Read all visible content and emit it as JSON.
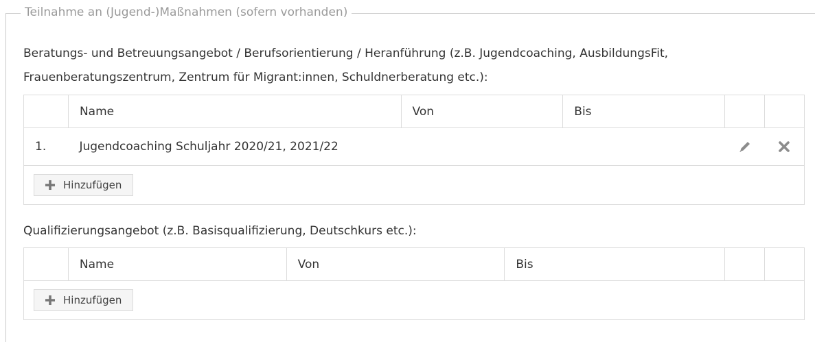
{
  "fieldset": {
    "legend": "Teilnahme an (Jugend-)Maßnahmen (sofern vorhanden)"
  },
  "section1": {
    "label_line1": "Beratungs- und Betreuungsangebot / Berufsorientierung / Heranführung (z.B. Jugendcoaching, AusbildungsFit,",
    "label_line2": "Frauenberatungszentrum, Zentrum für Migrant:innen, Schuldnerberatung etc.):",
    "columns": {
      "name": "Name",
      "von": "Von",
      "bis": "Bis"
    },
    "rows": [
      {
        "index": "1.",
        "name": "Jugendcoaching Schuljahr 2020/21, 2021/22",
        "von": "",
        "bis": ""
      }
    ],
    "add_label": "Hinzufügen"
  },
  "section2": {
    "label": "Qualifizierungsangebot (z.B. Basisqualifizierung, Deutschkurs etc.):",
    "columns": {
      "name": "Name",
      "von": "Von",
      "bis": "Bis"
    },
    "add_label": "Hinzufügen"
  },
  "icons": {
    "edit": "pencil-icon",
    "delete": "close-icon",
    "add": "plus-icon"
  },
  "colors": {
    "border": "#dcdcdc",
    "legend_text": "#9a9a9a",
    "icon_gray": "#8c8c8c",
    "button_bg": "#f5f5f5"
  }
}
